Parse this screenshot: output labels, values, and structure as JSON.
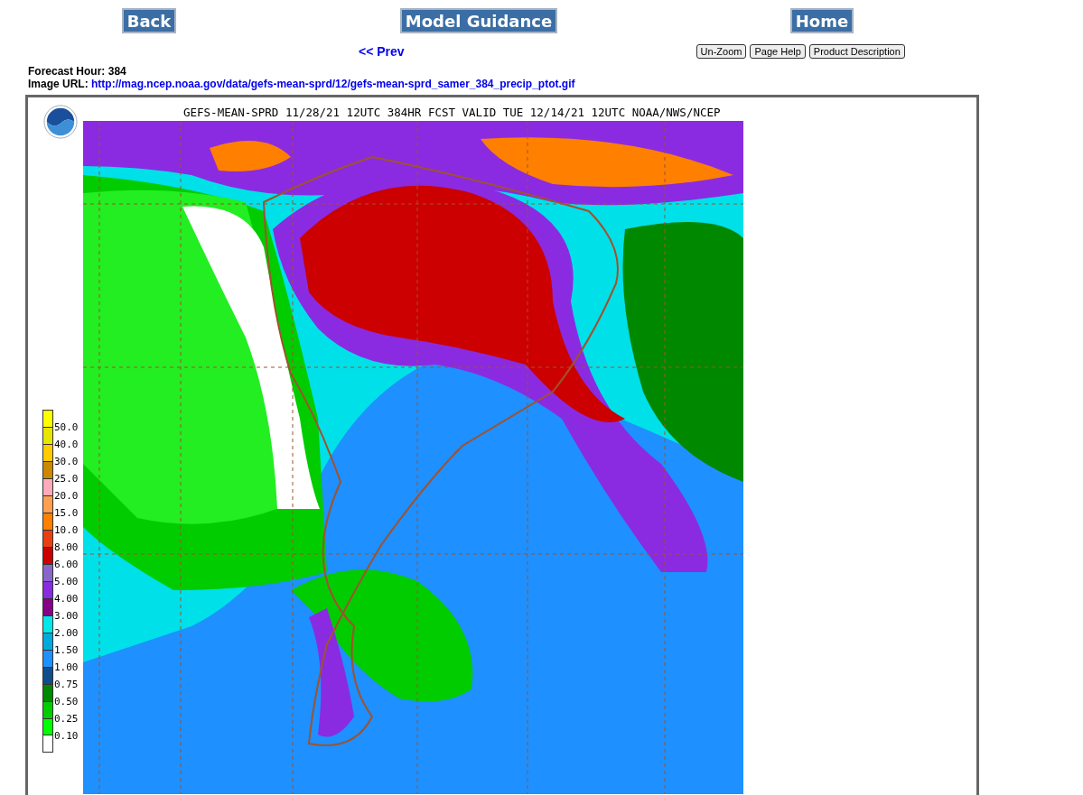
{
  "nav_buttons": [
    "Back",
    "Model Guidance",
    "Home"
  ],
  "prev_link": "<< Prev",
  "tool_buttons": [
    "Un-Zoom",
    "Page Help",
    "Product Description"
  ],
  "info": [
    {
      "label": "Forecast Hour:",
      "value": "384",
      "kind": "text"
    },
    {
      "label": "Image URL:",
      "value": "http://mag.ncep.noaa.gov/data/gefs-mean-sprd/12/gefs-mean-sprd_samer_384_precip_ptot.gif",
      "kind": "link"
    }
  ],
  "map": {
    "title": "GEFS-MEAN-SPRD 11/28/21 12UTC 384HR FCST VALID TUE 12/14/21 12UTC NOAA/NWS/NCEP",
    "legend": [
      {
        "label": "50.0",
        "color": "#ffff00"
      },
      {
        "label": "40.0",
        "color": "#e6e600"
      },
      {
        "label": "30.0",
        "color": "#ffcc00"
      },
      {
        "label": "25.0",
        "color": "#cc8800"
      },
      {
        "label": "20.0",
        "color": "#ffaabb"
      },
      {
        "label": "15.0",
        "color": "#ffa050"
      },
      {
        "label": "10.0",
        "color": "#ff7f00"
      },
      {
        "label": "8.00",
        "color": "#e84010"
      },
      {
        "label": "6.00",
        "color": "#cc0000"
      },
      {
        "label": "5.00",
        "color": "#8866cc"
      },
      {
        "label": "4.00",
        "color": "#8a2be2"
      },
      {
        "label": "3.00",
        "color": "#880088"
      },
      {
        "label": "2.00",
        "color": "#00e8e8"
      },
      {
        "label": "1.50",
        "color": "#00aadd"
      },
      {
        "label": "1.00",
        "color": "#1e90ff"
      },
      {
        "label": "0.75",
        "color": "#104e8b"
      },
      {
        "label": "0.50",
        "color": "#008800"
      },
      {
        "label": "0.25",
        "color": "#00cc00"
      },
      {
        "label": "0.10",
        "color": "#00ff00"
      },
      {
        "color": "#ffffff"
      }
    ]
  }
}
